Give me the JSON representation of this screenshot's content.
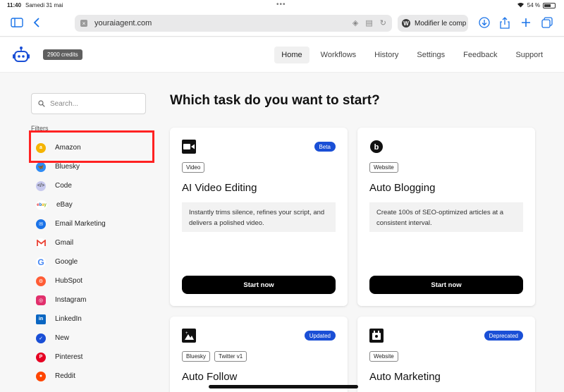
{
  "status_bar": {
    "time": "11:40",
    "date": "Samedi 31 mai",
    "battery": "54 %"
  },
  "browser": {
    "url": "youraiagent.com",
    "second_tab": "Modifier le comp"
  },
  "app": {
    "credits": "2900 credits",
    "nav": [
      "Home",
      "Workflows",
      "History",
      "Settings",
      "Feedback",
      "Support"
    ],
    "active_nav": "Home"
  },
  "sidebar": {
    "search_placeholder": "Search...",
    "filters_label": "Filters",
    "filters": [
      {
        "label": "Amazon",
        "icon": "amazon-icon",
        "color": "#f5b400"
      },
      {
        "label": "Bluesky",
        "icon": "bluesky-icon",
        "color": "#2f8cf5"
      },
      {
        "label": "Code",
        "icon": "code-icon",
        "color": "#c7c9ee"
      },
      {
        "label": "eBay",
        "icon": "ebay-icon",
        "color": "#ffffff"
      },
      {
        "label": "Email Marketing",
        "icon": "email-icon",
        "color": "#1a73e8"
      },
      {
        "label": "Gmail",
        "icon": "gmail-icon",
        "color": "#ffffff"
      },
      {
        "label": "Google",
        "icon": "google-icon",
        "color": "#ffffff"
      },
      {
        "label": "HubSpot",
        "icon": "hubspot-icon",
        "color": "#ff5c35"
      },
      {
        "label": "Instagram",
        "icon": "instagram-icon",
        "color": "#e1306c"
      },
      {
        "label": "LinkedIn",
        "icon": "linkedin-icon",
        "color": "#0a66c2"
      },
      {
        "label": "New",
        "icon": "new-icon",
        "color": "#1a4fd6"
      },
      {
        "label": "Pinterest",
        "icon": "pinterest-icon",
        "color": "#e60023"
      },
      {
        "label": "Reddit",
        "icon": "reddit-icon",
        "color": "#ff4500"
      }
    ]
  },
  "main": {
    "heading": "Which task do you want to start?",
    "cards": [
      {
        "title": "AI Video Editing",
        "badge": "Beta",
        "tags": [
          "Video"
        ],
        "icon": "video-camera-icon",
        "description": "Instantly trims silence, refines your script, and delivers a polished video.",
        "button": "Start now"
      },
      {
        "title": "Auto Blogging",
        "badge": "",
        "tags": [
          "Website"
        ],
        "icon": "blog-icon",
        "description": "Create 100s of SEO-optimized articles at a consistent interval.",
        "button": "Start now"
      },
      {
        "title": "Auto Follow",
        "badge": "Updated",
        "tags": [
          "Bluesky",
          "Twitter v1"
        ],
        "icon": "follow-icon"
      },
      {
        "title": "Auto Marketing",
        "badge": "Deprecated",
        "tags": [
          "Website"
        ],
        "icon": "marketing-icon"
      }
    ]
  }
}
